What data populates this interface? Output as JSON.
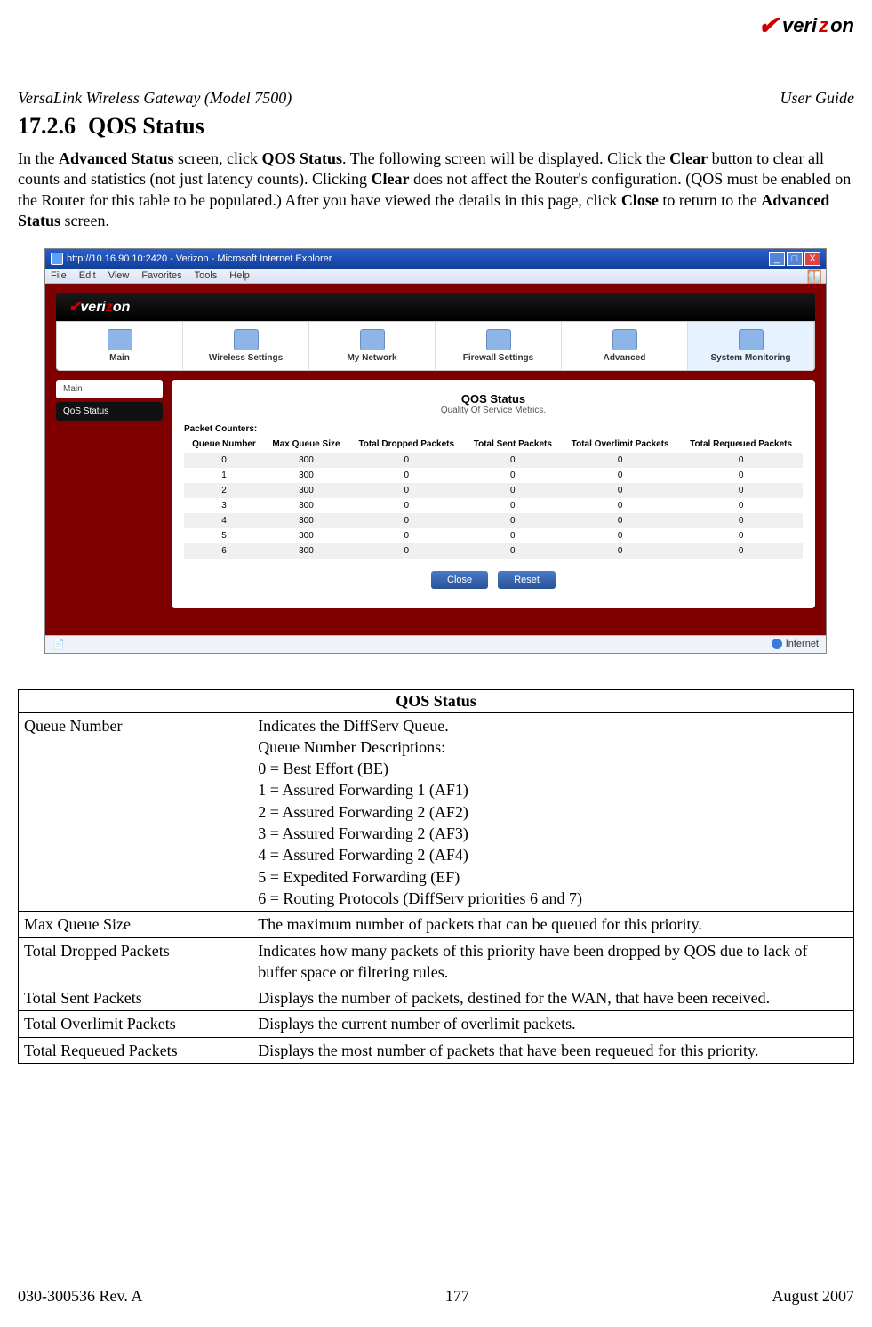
{
  "brand": {
    "pre": "veri",
    "accent": "z",
    "post": "on"
  },
  "docHeader": {
    "left": "VersaLink Wireless Gateway (Model 7500)",
    "right": "User Guide"
  },
  "heading": {
    "num": "17.2.6",
    "title": "QOS Status"
  },
  "paragraph": {
    "p1": "In the ",
    "b1": "Advanced Status",
    "p2": " screen, click ",
    "b2": "QOS Status",
    "p3": ". The following screen will be displayed. Click the ",
    "b3": "Clear",
    "p4": " button to clear all counts and statistics (not just latency counts). Clicking ",
    "b4": "Clear",
    "p5": " does not affect the Router's configuration. (QOS must be enabled on the Router for this table to be populated.) After you have viewed the details in this page, click ",
    "b5": "Close",
    "p6": " to return to the ",
    "b6": "Advanced Status",
    "p7": " screen."
  },
  "window": {
    "title": "http://10.16.90.10:2420 - Verizon - Microsoft Internet Explorer",
    "menus": [
      "File",
      "Edit",
      "View",
      "Favorites",
      "Tools",
      "Help"
    ],
    "winbtns": {
      "min": "_",
      "max": "□",
      "close": "X"
    },
    "statusbar": {
      "doneIcon": "⎙",
      "right": "Internet"
    }
  },
  "nav": {
    "brand": {
      "pre": "veri",
      "accent": "z",
      "post": "on"
    },
    "tabs": [
      {
        "label": "Main"
      },
      {
        "label": "Wireless Settings"
      },
      {
        "label": "My Network"
      },
      {
        "label": "Firewall Settings"
      },
      {
        "label": "Advanced"
      },
      {
        "label": "System Monitoring"
      }
    ]
  },
  "sidebar": {
    "items": [
      {
        "label": "Main",
        "active": false
      },
      {
        "label": "QoS Status",
        "active": true
      }
    ]
  },
  "panel": {
    "title": "QOS Status",
    "subtitle": "Quality Of Service Metrics.",
    "packetLabel": "Packet Counters:",
    "columns": [
      "Queue Number",
      "Max Queue Size",
      "Total Dropped Packets",
      "Total Sent Packets",
      "Total Overlimit Packets",
      "Total Requeued Packets"
    ],
    "rows": [
      [
        "0",
        "300",
        "0",
        "0",
        "0",
        "0"
      ],
      [
        "1",
        "300",
        "0",
        "0",
        "0",
        "0"
      ],
      [
        "2",
        "300",
        "0",
        "0",
        "0",
        "0"
      ],
      [
        "3",
        "300",
        "0",
        "0",
        "0",
        "0"
      ],
      [
        "4",
        "300",
        "0",
        "0",
        "0",
        "0"
      ],
      [
        "5",
        "300",
        "0",
        "0",
        "0",
        "0"
      ],
      [
        "6",
        "300",
        "0",
        "0",
        "0",
        "0"
      ]
    ],
    "buttons": {
      "close": "Close",
      "reset": "Reset"
    }
  },
  "descTable": {
    "header": "QOS Status",
    "rows": [
      {
        "term": "Queue Number",
        "def": "Indicates the DiffServ Queue.\nQueue Number Descriptions:\n0 = Best Effort (BE)\n1 = Assured Forwarding 1 (AF1)\n2 = Assured Forwarding 2 (AF2)\n3 = Assured Forwarding 2 (AF3)\n4 = Assured Forwarding 2 (AF4)\n5 = Expedited Forwarding (EF)\n6 = Routing Protocols (DiffServ priorities 6 and 7)"
      },
      {
        "term": "Max Queue Size",
        "def": "The maximum number of packets that can be queued for this priority."
      },
      {
        "term": "Total Dropped Packets",
        "def": "Indicates how many packets of this priority have been dropped by QOS due to lack of buffer space or filtering rules."
      },
      {
        "term": "Total Sent Packets",
        "def": "Displays the number of packets, destined for the WAN, that have been received."
      },
      {
        "term": "Total Overlimit Packets",
        "def": "Displays the current number of overlimit packets."
      },
      {
        "term": "Total Requeued Packets",
        "def": "Displays the most number of packets that have been requeued for this priority."
      }
    ]
  },
  "footer": {
    "left": "030-300536 Rev. A",
    "center": "177",
    "right": "August 2007"
  }
}
